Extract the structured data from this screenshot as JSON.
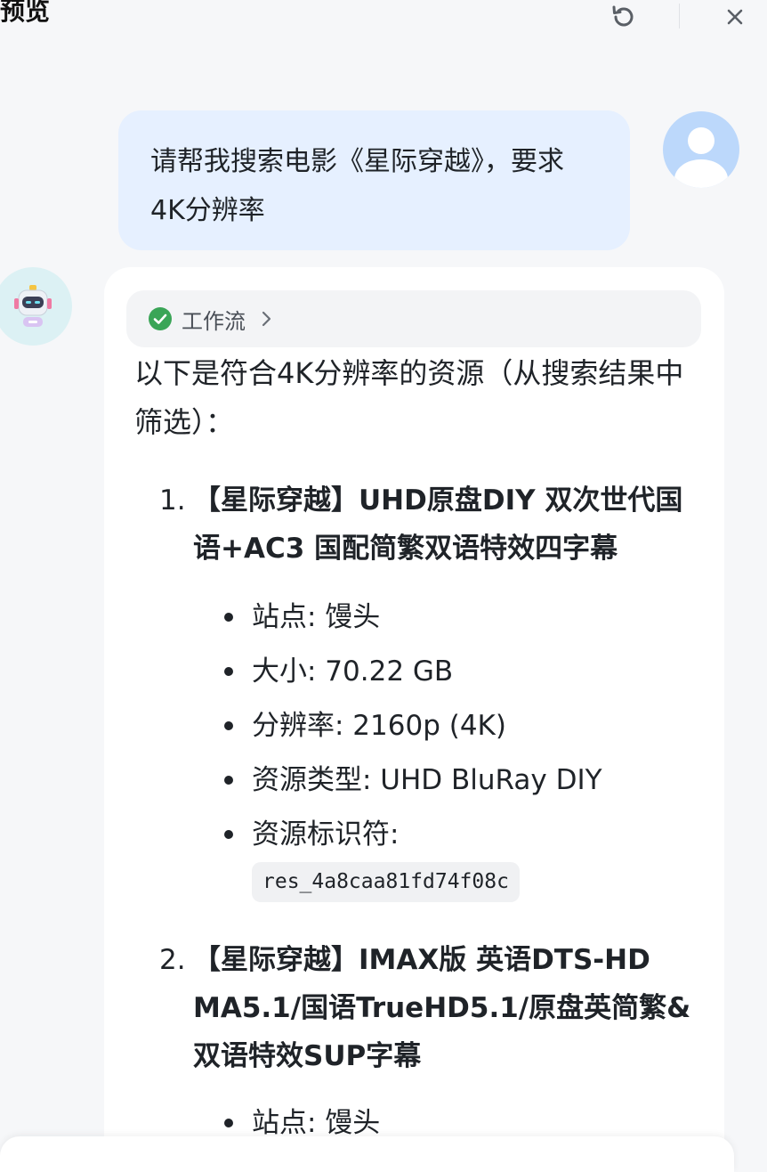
{
  "header": {
    "title": "预览"
  },
  "user_message": {
    "text": "请帮我搜索电影《星际穿越》，要求4K分辨率"
  },
  "assistant": {
    "workflow_label": "工作流",
    "intro": "以下是符合4K分辨率的资源（从搜索结果中筛选）：",
    "results": [
      {
        "num": "1.",
        "title": "【星际穿越】UHD原盘DIY 双次世代国语+AC3 国配简繁双语特效四字幕",
        "site": "站点: 馒头",
        "size": "大小: 70.22 GB",
        "resolution": "分辨率: 2160p (4K)",
        "type": "资源类型: UHD BluRay DIY",
        "id_label": "资源标识符:",
        "id_code": "res_4a8caa81fd74f08c"
      },
      {
        "num": "2.",
        "title": "【星际穿越】IMAX版 英语DTS-HD MA5.1/国语TrueHD5.1/原盘英简繁&双语特效SUP字幕",
        "site": "站点: 馒头"
      }
    ]
  },
  "colors": {
    "accent_green": "#3aa557",
    "user_bubble": "#e6f0ff"
  }
}
